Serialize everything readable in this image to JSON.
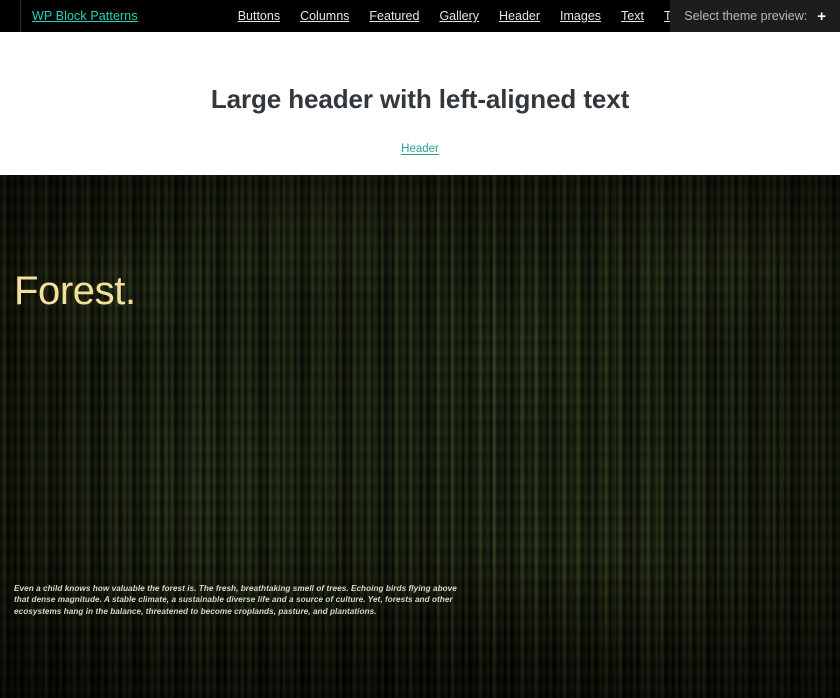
{
  "adminbar": {
    "brand": "WP Block Patterns",
    "nav_items": [
      {
        "label": "Buttons"
      },
      {
        "label": "Columns"
      },
      {
        "label": "Featured"
      },
      {
        "label": "Gallery"
      },
      {
        "label": "Header"
      },
      {
        "label": "Images"
      },
      {
        "label": "Text"
      },
      {
        "label": "Themes"
      }
    ],
    "theme_preview": {
      "label": "Select theme preview:",
      "add_icon": "+"
    },
    "colors": {
      "background": "#000000",
      "brand_text": "#24d3b5",
      "nav_text": "#e6e6e6",
      "themebox_background": "#1d1d1d"
    }
  },
  "pattern_header": {
    "title": "Large header with left-aligned text",
    "category_link": "Header",
    "colors": {
      "title_text": "#32373c",
      "link_text": "#2aa198",
      "background": "#ffffff"
    }
  },
  "hero": {
    "heading": "Forest.",
    "paragraph": "Even a child knows how valuable the forest is. The fresh, breathtaking smell of trees. Echoing birds flying above that dense magnitude. A stable climate, a sustainable diverse life and a source of culture. Yet, forests and other ecosystems hang in the balance, threatened to become croplands, pasture, and plantations.",
    "colors": {
      "heading_text": "#f5e09a",
      "paragraph_text": "#d9d8c4",
      "image_base": "#16200f"
    }
  }
}
